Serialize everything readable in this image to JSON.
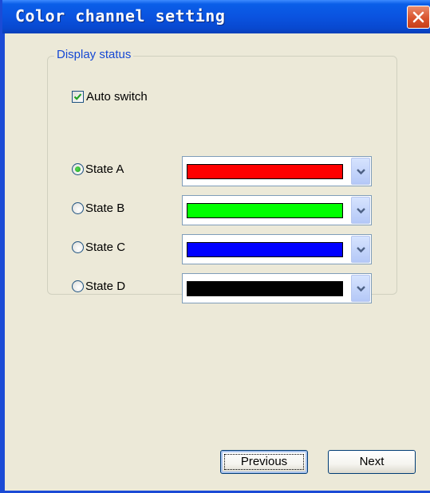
{
  "window": {
    "title": "Color channel setting"
  },
  "group": {
    "title": "Display status",
    "auto_switch": {
      "label": "Auto switch",
      "checked": true
    },
    "states": [
      {
        "label": "State A",
        "selected": true,
        "color": "#ff0000"
      },
      {
        "label": "State B",
        "selected": false,
        "color": "#00ff00"
      },
      {
        "label": "State C",
        "selected": false,
        "color": "#0000ff"
      },
      {
        "label": "State D",
        "selected": false,
        "color": "#000000"
      }
    ]
  },
  "buttons": {
    "previous": "Previous",
    "next": "Next"
  },
  "icons": {
    "close": "close-icon",
    "check": "checkmark-icon",
    "dropdown": "chevron-down-icon"
  }
}
